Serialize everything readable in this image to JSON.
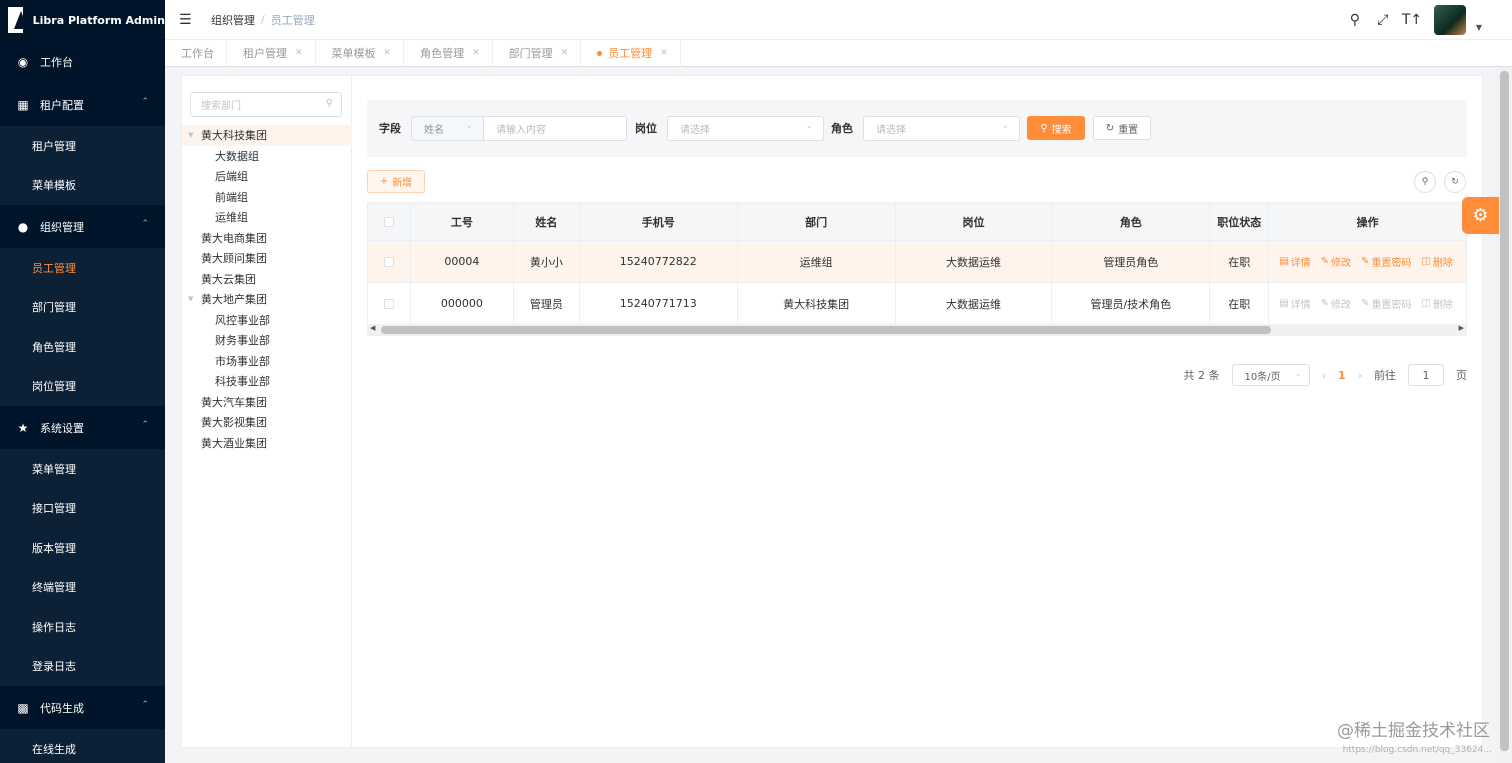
{
  "app": {
    "title": "Libra Platform Admin"
  },
  "sidebar": {
    "items": [
      {
        "type": "item",
        "icon": "dashboard-icon",
        "label": "工作台"
      },
      {
        "type": "group",
        "icon": "grid-icon",
        "label": "租户配置",
        "children": [
          "租户管理",
          "菜单模板"
        ]
      },
      {
        "type": "group",
        "icon": "user-icon",
        "label": "组织管理",
        "children": [
          "员工管理",
          "部门管理",
          "角色管理",
          "岗位管理"
        ],
        "active_child": "员工管理"
      },
      {
        "type": "group",
        "icon": "star-icon",
        "label": "系统设置",
        "children": [
          "菜单管理",
          "接口管理",
          "版本管理",
          "终端管理",
          "操作日志",
          "登录日志"
        ]
      },
      {
        "type": "group",
        "icon": "apps-icon",
        "label": "代码生成",
        "children": [
          "在线生成"
        ]
      }
    ]
  },
  "header": {
    "breadcrumb": [
      "组织管理",
      "员工管理"
    ]
  },
  "tags": [
    {
      "label": "工作台",
      "closable": false,
      "active": false
    },
    {
      "label": "租户管理",
      "closable": true,
      "active": false
    },
    {
      "label": "菜单模板",
      "closable": true,
      "active": false
    },
    {
      "label": "角色管理",
      "closable": true,
      "active": false
    },
    {
      "label": "部门管理",
      "closable": true,
      "active": false
    },
    {
      "label": "员工管理",
      "closable": true,
      "active": true
    }
  ],
  "tree": {
    "search_placeholder": "搜索部门",
    "nodes": [
      {
        "label": "黄大科技集团",
        "level": 0,
        "expanded": true,
        "selected": true
      },
      {
        "label": "大数据组",
        "level": 1
      },
      {
        "label": "后端组",
        "level": 1
      },
      {
        "label": "前端组",
        "level": 1
      },
      {
        "label": "运维组",
        "level": 1
      },
      {
        "label": "黄大电商集团",
        "level": 0
      },
      {
        "label": "黄大顾问集团",
        "level": 0
      },
      {
        "label": "黄大云集团",
        "level": 0
      },
      {
        "label": "黄大地产集团",
        "level": 0,
        "expanded": true
      },
      {
        "label": "风控事业部",
        "level": 1
      },
      {
        "label": "财务事业部",
        "level": 1
      },
      {
        "label": "市场事业部",
        "level": 1
      },
      {
        "label": "科技事业部",
        "level": 1
      },
      {
        "label": "黄大汽车集团",
        "level": 0
      },
      {
        "label": "黄大影视集团",
        "level": 0
      },
      {
        "label": "黄大酒业集团",
        "level": 0
      }
    ]
  },
  "filter": {
    "field_label": "字段",
    "field_select": "姓名",
    "field_input_placeholder": "请输入内容",
    "post_label": "岗位",
    "post_placeholder": "请选择",
    "role_label": "角色",
    "role_placeholder": "请选择",
    "search_btn": "搜索",
    "reset_btn": "重置"
  },
  "toolbar": {
    "add_btn": "新增"
  },
  "table": {
    "columns": [
      "工号",
      "姓名",
      "手机号",
      "部门",
      "岗位",
      "角色",
      "职位状态",
      "操作"
    ],
    "rows": [
      {
        "id": "00004",
        "name": "黄小小",
        "phone": "15240772822",
        "dept": "运维组",
        "post": "大数据运维",
        "role": "管理员角色",
        "status": "在职",
        "ops_enabled": true
      },
      {
        "id": "000000",
        "name": "管理员",
        "phone": "15240771713",
        "dept": "黄大科技集团",
        "post": "大数据运维",
        "role": "管理员/技术角色",
        "status": "在职",
        "ops_enabled": false
      }
    ],
    "ops": [
      "详情",
      "修改",
      "重置密码",
      "删除"
    ]
  },
  "pager": {
    "total": "共 2 条",
    "page_size": "10条/页",
    "current": "1",
    "goto_label": "前往",
    "goto_value": "1",
    "page_suffix": "页"
  },
  "watermark": {
    "main": "@稀土掘金技术社区",
    "url": "https://blog.csdn.net/qq_33624..."
  },
  "colors": {
    "accent": "#ff8c38",
    "sidebar": "#001529"
  }
}
